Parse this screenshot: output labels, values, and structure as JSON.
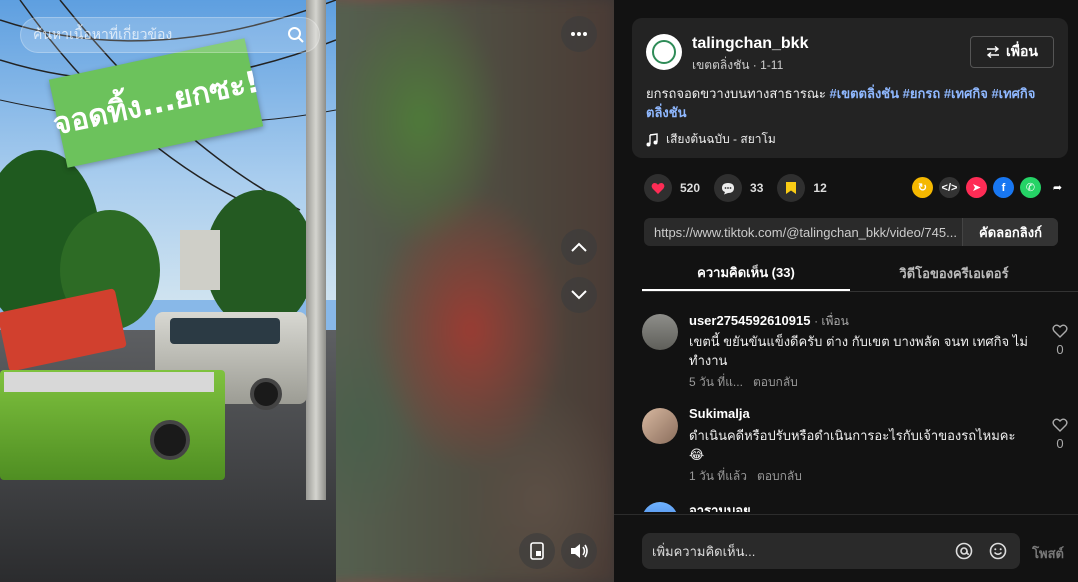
{
  "video": {
    "search_placeholder": "ค้นหาเนื้อหาที่เกี่ยวข้อง",
    "overlay_sign": "จอดทิ้ง...ยกซะ!"
  },
  "author": {
    "name": "talingchan_bkk",
    "meta": "เขตตลิ่งชัน · 1-11",
    "friend_label": "เพื่อน"
  },
  "caption": {
    "text": "ยกรถจอดขวางบนทางสาธารณะ",
    "tags": [
      "#เขตตลิ่งชัน",
      "#ยกรถ",
      "#เทศกิจ",
      "#เทศกิจตลิ่งชัน"
    ],
    "sound": "เสียงต้นฉบับ - สยาโม"
  },
  "actions": {
    "likes": "520",
    "comments": "33",
    "saves": "12"
  },
  "link": {
    "url": "https://www.tiktok.com/@talingchan_bkk/video/745...",
    "copy_label": "คัดลอกลิงก์"
  },
  "tabs": [
    {
      "label": "ความคิดเห็น (33)",
      "active": true
    },
    {
      "label": "วิดีโอของครีเอเตอร์",
      "active": false
    }
  ],
  "comments": [
    {
      "user": "user2754592610915",
      "badge": "· เพื่อน",
      "text": "เขตนี้ ขยันขันแข็งดีครับ ต่าง กับเขต บางพลัด จนท เทศกิจ ไม่ทำงาน",
      "time": "5 วัน ที่แ...",
      "reply": "ตอบกลับ",
      "likes": "0"
    },
    {
      "user": "Sukimalja",
      "badge": "",
      "text": "ดำเนินคดีหรือปรับหรือดำเนินการอะไรกับเจ้าของรถไหมคะ 😂",
      "time": "1 วัน ที่แล้ว",
      "reply": "ตอบกลับ",
      "likes": "0"
    },
    {
      "user": "อารามบอย",
      "badge": "",
      "text": "",
      "time": "",
      "reply": "",
      "likes": ""
    }
  ],
  "compose": {
    "placeholder": "เพิ่มความคิดเห็น...",
    "post_label": "โพสต์"
  },
  "colors": {
    "like": "#fe2c55",
    "save": "#facc15",
    "tag": "#8fb8ff",
    "panel_bg": "#121212",
    "card_bg": "#232323"
  }
}
